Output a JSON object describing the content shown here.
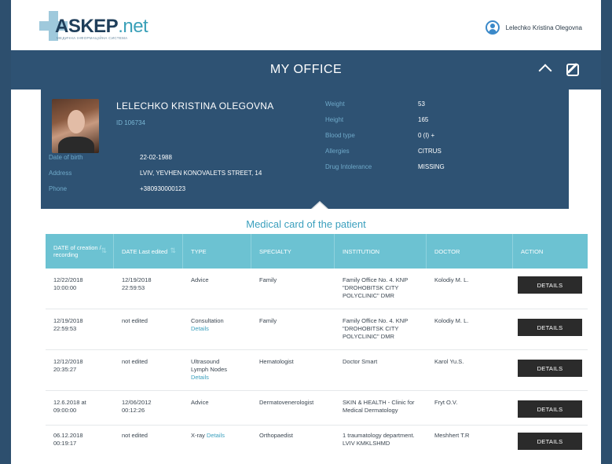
{
  "header": {
    "logo_main": "ASKEP",
    "logo_suffix": ".net",
    "logo_tagline": "МЕДИЧНА ІНФОРМАЦІЙНА СИСТЕМА",
    "user_name": "Lelechko Kristina Olegovna"
  },
  "office": {
    "title": "MY OFFICE"
  },
  "patient": {
    "name": "LELECHKO KRISTINA OLEGOVNA",
    "id": "ID 106734",
    "fields": [
      {
        "label": "Date of birth",
        "value": "22-02-1988"
      },
      {
        "label": "Address",
        "value": "LVIV, YEVHEN KONOVALETS STREET, 14"
      },
      {
        "label": "Phone",
        "value": "+380930000123"
      }
    ],
    "vitals": [
      {
        "label": "Weight",
        "value": "53"
      },
      {
        "label": "Height",
        "value": "165"
      },
      {
        "label": "Blood type",
        "value": "0 (I) +"
      },
      {
        "label": "Allergies",
        "value": "CITRUS"
      },
      {
        "label": "Drug Intolerance",
        "value": "MISSING"
      }
    ]
  },
  "card": {
    "title": "Medical card of the patient",
    "columns": [
      "DATE of creation / recording",
      "DATE Last edited",
      "TYPE",
      "SPECIALTY",
      "INSTITUTION",
      "DOCTOR",
      "ACTION"
    ],
    "rows": [
      {
        "created": "12/22/2018\n10:00:00",
        "edited": "12/19/2018\n22:59:53",
        "type": "Advice",
        "type_link": "",
        "specialty": "Family",
        "institution": "Family Office No. 4. KNP \"DROHOBITSK CITY POLYCLINIC\" DMR",
        "doctor": "Kolodiy M. L.",
        "action": "DETAILS"
      },
      {
        "created": "12/19/2018\n22:59:53",
        "edited": "not edited",
        "type": "Consultation",
        "type_link": "Details",
        "specialty": "Family",
        "institution": "Family Office No. 4. KNP \"DROHOBITSK CITY POLYCLINIC\" DMR",
        "doctor": "Kolodiy M. L.",
        "action": "DETAILS"
      },
      {
        "created": "12/12/2018\n20:35:27",
        "edited": "not edited",
        "type": "Ultrasound\nLymph Nodes",
        "type_link": "Details",
        "specialty": "Hematologist",
        "institution": "Doctor Smart",
        "doctor": "Karol Yu.S.",
        "action": "DETAILS"
      },
      {
        "created": "12.6.2018 at\n09:00:00",
        "edited": "12/06/2012\n00:12:26",
        "type": "Advice",
        "type_link": "",
        "specialty": "Dermatovenerologist",
        "institution": "SKIN & HEALTH - Clinic for Medical Dermatology",
        "doctor": "Fryt O.V.",
        "action": "DETAILS"
      },
      {
        "created": "06.12.2018\n00:19:17",
        "edited": "not edited",
        "type": "X-ray",
        "type_link": "Details",
        "specialty": "Orthopaedist",
        "institution": "1 traumatology department. LVIV KMKLSHMD",
        "doctor": "Meshhert T.R",
        "action": "DETAILS"
      }
    ]
  }
}
